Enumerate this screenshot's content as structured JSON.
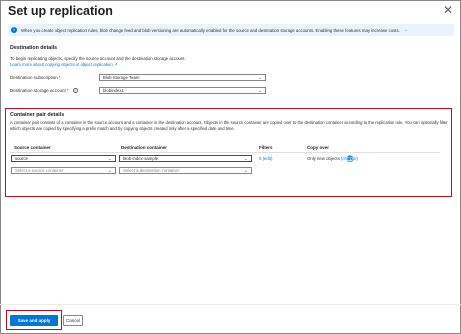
{
  "panel": {
    "title": "Set up replication",
    "close_glyph": "✕"
  },
  "banner": {
    "text": "When you create object replication rules, blob change feed and blob versioning are automatically enabled for the source and destination storage accounts. Enabling these features may increase costs.",
    "arrow": "→"
  },
  "destination": {
    "heading": "Destination details",
    "description": "To begin replicating objects, specify the source account and the destination storage account.",
    "learn_more": "Learn more about copying objects in object replication ↗",
    "subscription_label": "Destination subscription",
    "subscription_value": "Blob Storage Team",
    "account_label": "Destination storage account",
    "account_value": "blobindex1",
    "required_mark": "*",
    "info_glyph": "i"
  },
  "container_pair": {
    "heading": "Container pair details",
    "description": "A container pair consists of a container in the source account and a container in the destination account. Objects in the source container are copied over to the destination container according to the replication rule. You can optionally filter which objects are copied by specifying a prefix match and by copying objects created only after a specified date and time.",
    "columns": {
      "source": "Source container",
      "destination": "Destination container",
      "filters": "Filters",
      "copy_over": "Copy over"
    },
    "rows": [
      {
        "source": "source",
        "destination": "blob-index-sample",
        "filters": "0 (edit)",
        "copy_over_text": "Only new objects",
        "copy_over_link": "(change)"
      }
    ],
    "empty_row": {
      "source_placeholder": "Select a source container",
      "destination_placeholder": "Select a destination container"
    }
  },
  "footer": {
    "save_label": "Save and apply",
    "cancel_label": "Cancel"
  },
  "icons": {
    "close": "close-icon",
    "info": "info-icon",
    "chevron": "chevron-down-icon",
    "delete": "trash-icon",
    "arrow": "arrow-right-icon"
  },
  "colors": {
    "accent": "#0078d4",
    "highlight": "#c50f1f",
    "banner_bg": "#eaf3fc"
  }
}
